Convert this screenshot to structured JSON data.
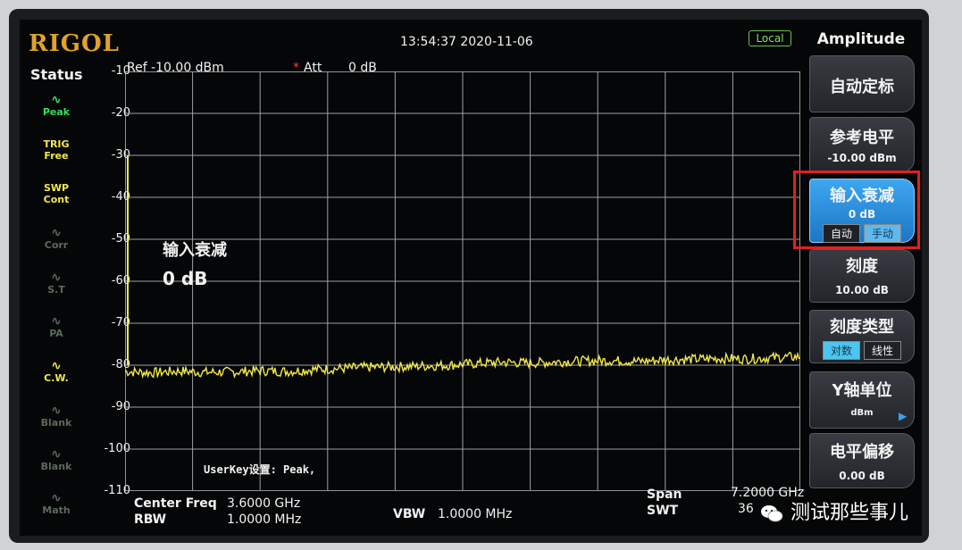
{
  "header": {
    "brand": "RIGOL",
    "datetime": "13:54:37 2020-11-06",
    "mode_badge": "Local"
  },
  "status_panel": {
    "title": "Status",
    "items": [
      {
        "name": "peak",
        "label": "Peak",
        "color": "#2ee05a",
        "icon": "peak-icon"
      },
      {
        "name": "trig",
        "label": "TRIG\nFree",
        "color": "#f2e84a",
        "icon": ""
      },
      {
        "name": "swp",
        "label": "SWP\nCont",
        "color": "#f2e84a",
        "icon": ""
      },
      {
        "name": "corr",
        "label": "Corr",
        "color": "#5a6a5a",
        "icon": "corr-icon"
      },
      {
        "name": "st",
        "label": "S.T",
        "color": "#5a6a5a",
        "icon": "wave-icon"
      },
      {
        "name": "pa",
        "label": "PA",
        "color": "#5a6a5a",
        "icon": "amp-icon"
      },
      {
        "name": "cw",
        "label": "C.W.",
        "color": "#f2e84a",
        "icon": "wave-icon"
      },
      {
        "name": "blank1",
        "label": "Blank",
        "color": "#5a6a5a",
        "icon": "wave-icon"
      },
      {
        "name": "blank2",
        "label": "Blank",
        "color": "#5a6a5a",
        "icon": "wave-icon"
      },
      {
        "name": "math",
        "label": "Math",
        "color": "#5a6a5a",
        "icon": "wave-icon"
      }
    ]
  },
  "display": {
    "ref_level": "Ref -10.00 dBm",
    "att_marker": "*",
    "att_label": "Att",
    "att_value": "0 dB",
    "overlay_title": "输入衰减",
    "overlay_value": "0 dB",
    "userkey": "UserKey设置:  Peak,"
  },
  "chart_data": {
    "type": "line",
    "title": "",
    "xlabel": "",
    "ylabel": "",
    "ylim": [
      -110,
      -10
    ],
    "yticks": [
      "-10",
      "-20",
      "-30",
      "-40",
      "-50",
      "-60",
      "-70",
      "-80",
      "-90",
      "-100",
      "-110"
    ],
    "x_range_ghz": [
      0,
      7.2
    ],
    "grid": true,
    "trace_color": "#f2e84a",
    "series": [
      {
        "values_dbm": [
          -81.5,
          -81.8,
          -81.4,
          -81.7,
          -81.6,
          -81.3,
          -81.5,
          -81.0,
          -80.8,
          -80.5,
          -80.4,
          -80.2,
          -80.0,
          -79.6,
          -79.3,
          -79.5,
          -79.2,
          -79.0,
          -78.9,
          -79.1,
          -78.7,
          -78.6,
          -78.4,
          -78.5,
          -78.2,
          -78.0
        ]
      }
    ]
  },
  "bottom_bar": {
    "center_freq_label": "Center Freq",
    "center_freq_value": "3.6000 GHz",
    "rbw_label": "RBW",
    "rbw_value": "1.0000 MHz",
    "vbw_label": "VBW",
    "vbw_value": "1.0000 MHz",
    "span_label": "Span",
    "span_value": "7.2000 GHz",
    "swt_label": "SWT",
    "swt_value": "36"
  },
  "softkey_menu": {
    "title": "Amplitude",
    "auto_scale": "自动定标",
    "ref_level_label": "参考电平",
    "ref_level_value": "-10.00 dBm",
    "input_atten_label": "输入衰减",
    "input_atten_value": "0 dB",
    "input_atten_auto": "自动",
    "input_atten_manual": "手动",
    "scale_label": "刻度",
    "scale_value": "10.00 dB",
    "scale_type_label": "刻度类型",
    "scale_type_log": "对数",
    "scale_type_lin": "线性",
    "y_unit_label": "Y轴单位",
    "y_unit_value": "dBm",
    "ref_offset_label": "电平偏移",
    "ref_offset_value": "0.00 dB",
    "accent_color": "#3ea6f0"
  },
  "watermark": {
    "text": "测试那些事儿"
  }
}
